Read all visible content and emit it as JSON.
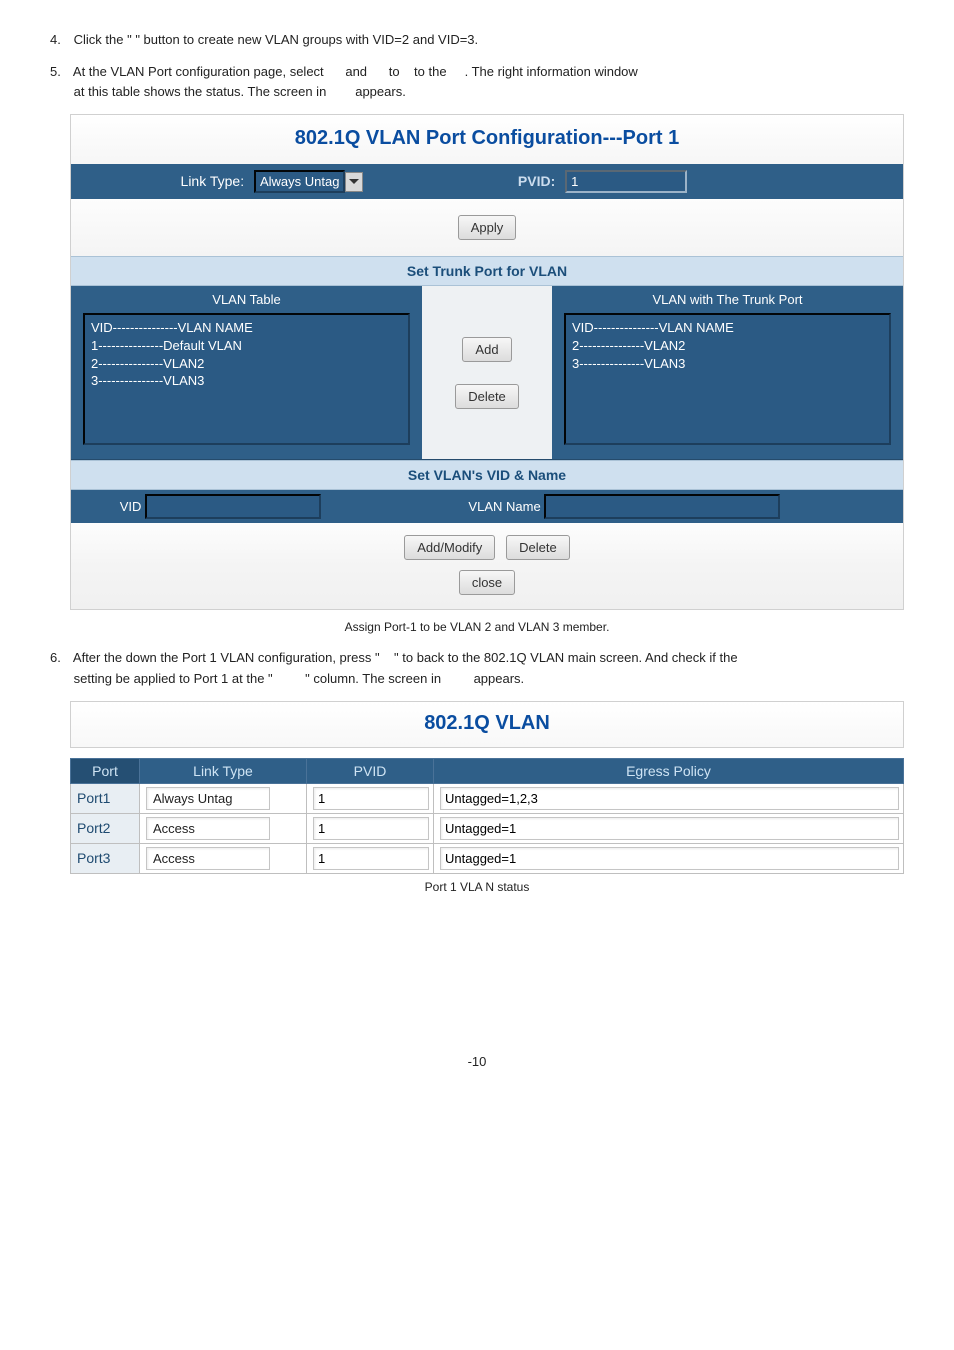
{
  "steps": {
    "s4": {
      "num": "4.",
      "a": "Click the \"",
      "b": "\" button to create new VLAN groups with VID=2 and VID=3."
    },
    "s5": {
      "num": "5.",
      "a": "At the ",
      "b": "VLAN Port configuration page, select ",
      "c": "and ",
      "d": "to ",
      "e": "to the ",
      "f": ". The right information window",
      "g": "at this table shows the status. The screen in ",
      "h": "appears."
    },
    "s6": {
      "num": "6.",
      "a": "After the down the Port 1 VLAN configuration, press \" ",
      "b": "\" to back to the 802.1Q VLAN main screen. And check if the",
      "c": "setting be applied to Port 1 at the \" ",
      "d": "\" column. The screen in ",
      "e": "appears."
    }
  },
  "panel": {
    "title": "802.1Q VLAN Port Configuration---Port 1",
    "link_type_label": "Link Type:",
    "link_type_value": "Always Untag",
    "pvid_label": "PVID:",
    "pvid_value": "1",
    "apply": "Apply",
    "trunk_head": "Set Trunk Port for VLAN",
    "vlan_table_hd": "VLAN Table",
    "trunk_hd": "VLAN with The Trunk Port",
    "vlan_table": [
      "VID---------------VLAN NAME",
      "1---------------Default VLAN",
      "2---------------VLAN2",
      "3---------------VLAN3"
    ],
    "trunk_list": [
      "VID---------------VLAN NAME",
      "2---------------VLAN2",
      "3---------------VLAN3"
    ],
    "add": "Add",
    "delete": "Delete",
    "vidname_head": "Set VLAN's VID & Name",
    "vid_label": "VID",
    "vlan_name_label": "VLAN Name",
    "addmodify": "Add/Modify",
    "delete2": "Delete",
    "close": "close"
  },
  "captions": {
    "c1": "Assign Port-1 to be VLAN 2 and VLAN 3 member.",
    "c2": "Port 1 VLA N status"
  },
  "vlan_title": "802.1Q   VLAN",
  "table": {
    "headers": {
      "port": "Port",
      "linktype": "Link Type",
      "pvid": "PVID",
      "egress": "Egress Policy"
    },
    "rows": [
      {
        "port": "Port1",
        "linktype": "Always Untag",
        "pvid": "1",
        "egress": "Untagged=1,2,3"
      },
      {
        "port": "Port2",
        "linktype": "Access",
        "pvid": "1",
        "egress": "Untagged=1"
      },
      {
        "port": "Port3",
        "linktype": "Access",
        "pvid": "1",
        "egress": "Untagged=1"
      }
    ]
  },
  "footer": "-10"
}
